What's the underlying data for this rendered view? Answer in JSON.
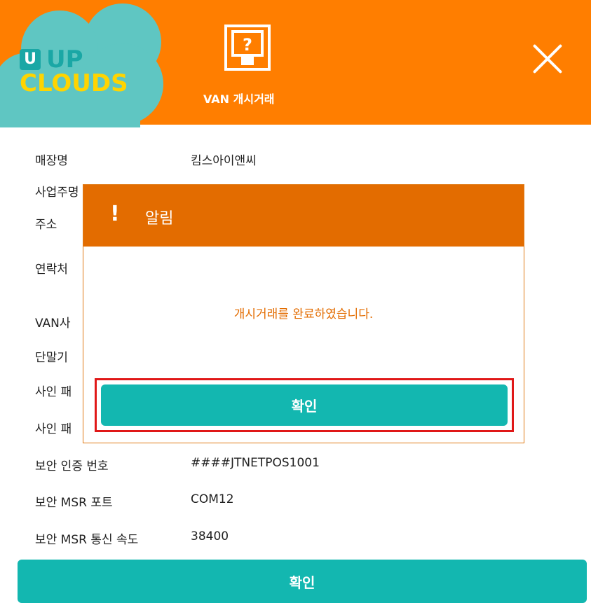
{
  "header": {
    "logo_line1": "UP",
    "logo_line2": "CLOUDS",
    "logo_badge": "U",
    "title": "VAN 개시거래",
    "icon": "question-screen-icon"
  },
  "form": {
    "rows": [
      {
        "label": "매장명",
        "value": "킴스아이앤씨"
      },
      {
        "label": "사업주명",
        "value": ""
      },
      {
        "label": "주소",
        "value": ""
      },
      {
        "label": "연락처",
        "value": ""
      },
      {
        "label": "VAN사",
        "value": ""
      },
      {
        "label": "단말기",
        "value": ""
      },
      {
        "label": "사인 패",
        "value": ""
      },
      {
        "label": "사인 패",
        "value": ""
      },
      {
        "label": "보안 인증 번호",
        "value": "####JTNETPOS1001"
      },
      {
        "label": "보안 MSR 포트",
        "value": "COM12"
      },
      {
        "label": "보안 MSR 통신 속도",
        "value": "38400"
      }
    ]
  },
  "bottom_button_label": "확인",
  "modal": {
    "alert_icon": "!",
    "title": "알림",
    "message": "개시거래를 완료하였습니다.",
    "confirm_label": "확인"
  },
  "colors": {
    "header": "#ff7e00",
    "modal_header": "#e36c00",
    "button": "#13b7b0",
    "highlight": "#e01818",
    "logo_cloud": "#5fc6c2",
    "logo_text": "#ffd400"
  }
}
